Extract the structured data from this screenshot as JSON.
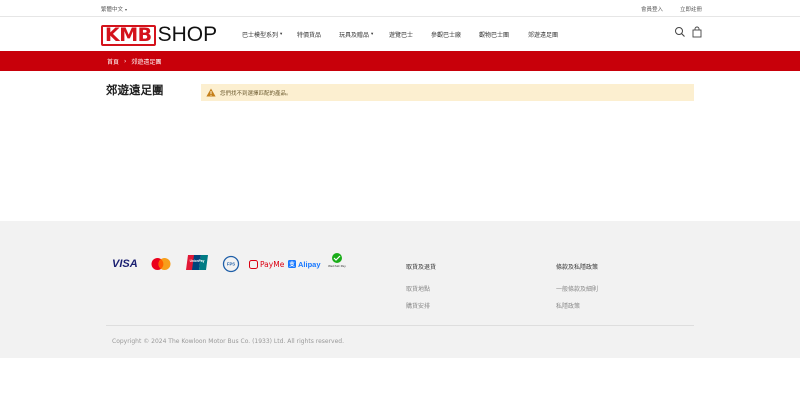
{
  "topbar": {
    "language": "繁體中文",
    "login": "會員登入",
    "register": "立即註冊"
  },
  "logo": {
    "kmb": "KMB",
    "shop": "SHOP"
  },
  "nav": [
    {
      "label": "巴士模型系列",
      "dropdown": true
    },
    {
      "label": "特價貨品",
      "dropdown": false
    },
    {
      "label": "玩具及贈品",
      "dropdown": true
    },
    {
      "label": "遊覽巴士",
      "dropdown": false
    },
    {
      "label": "參觀巴士廠",
      "dropdown": false
    },
    {
      "label": "觀物巴士團",
      "dropdown": false
    },
    {
      "label": "郊遊遠足團",
      "dropdown": false
    }
  ],
  "breadcrumb": {
    "home": "首頁",
    "separator": "›",
    "current": "郊遊遠足團"
  },
  "page_title": "郊遊遠足團",
  "alert": {
    "message": "您們找不到選擇匹配的產品。"
  },
  "footer": {
    "payments": {
      "visa": "VISA",
      "payme": "PayMe",
      "alipay": "Alipay",
      "wechat": "WeChat Pay"
    },
    "col1": {
      "title": "取貨及退貨",
      "links": [
        "取貨地點",
        "購貨安排"
      ]
    },
    "col2": {
      "title": "條款及私隱政策",
      "links": [
        "一般條款及細則",
        "私隱政策"
      ]
    },
    "copyright": "Copyright © 2024 The Kowloon Motor Bus Co. (1933) Ltd. All rights reserved."
  },
  "colors": {
    "brand_red": "#c8000a",
    "alert_bg": "#fcefd0",
    "footer_bg": "#f2f2f2"
  }
}
